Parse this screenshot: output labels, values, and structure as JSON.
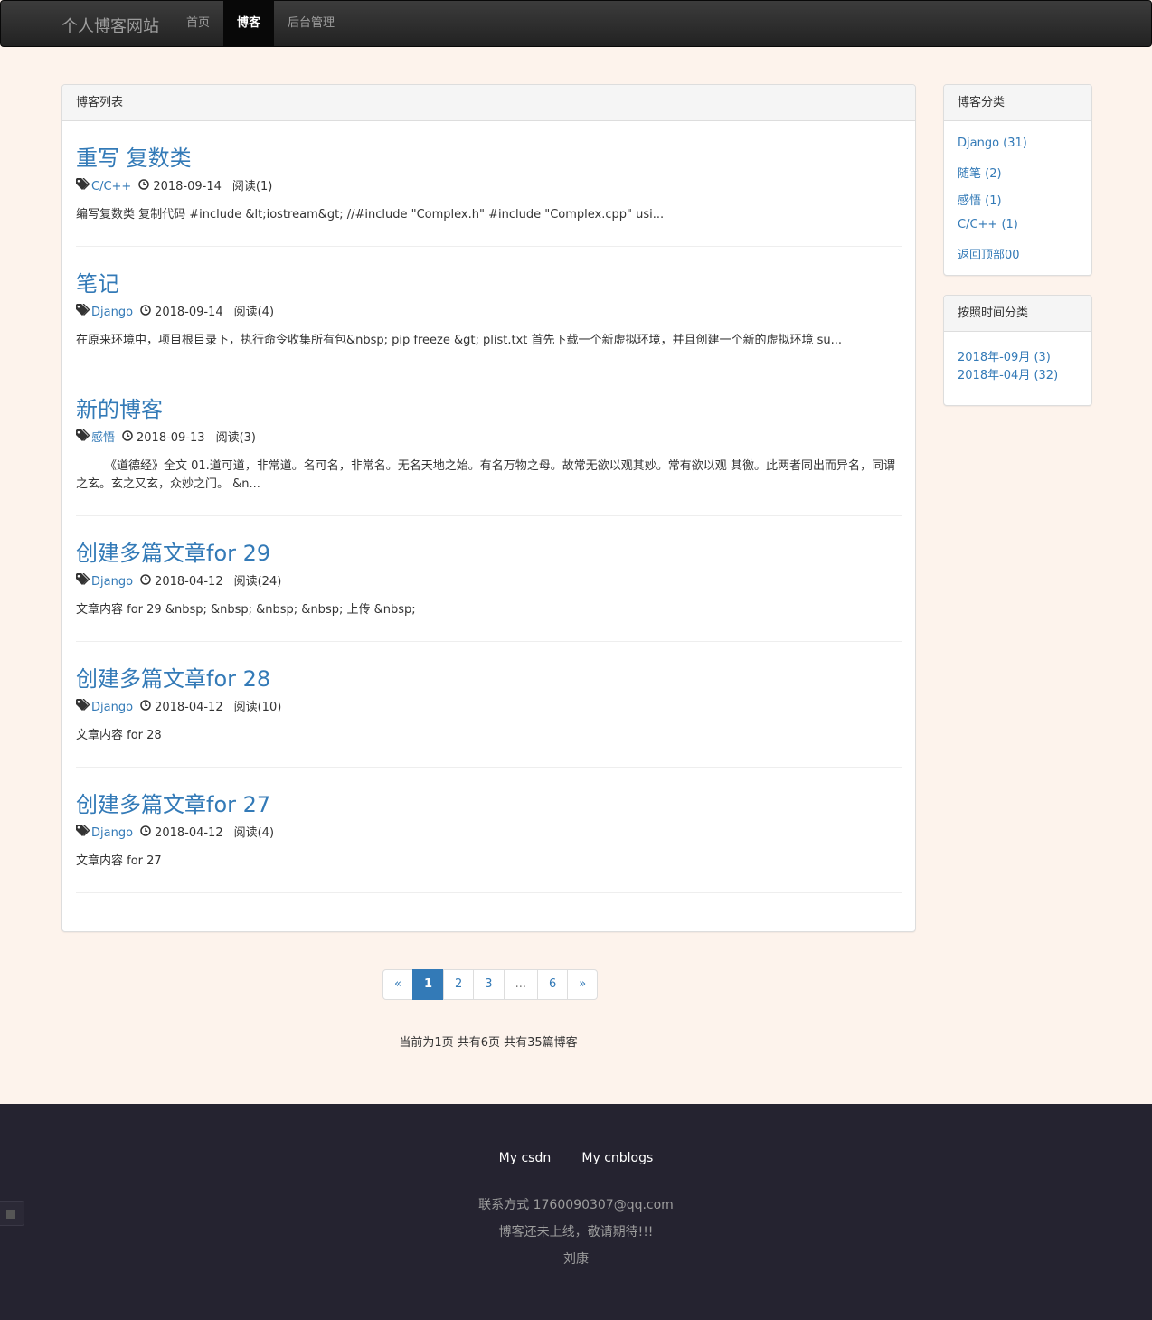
{
  "navbar": {
    "brand": "个人博客网站",
    "items": [
      {
        "label": "首页",
        "active": false
      },
      {
        "label": "博客",
        "active": true
      },
      {
        "label": "后台管理",
        "active": false
      }
    ]
  },
  "main": {
    "heading": "博客列表",
    "posts": [
      {
        "title": "重写 复数类",
        "category": "C/C++",
        "date": "2018-09-14",
        "views": "阅读(1)",
        "summary": "编写复数类 复制代码 #include &lt;iostream&gt; //#include \"Complex.h\" #include \"Complex.cpp\" usi..."
      },
      {
        "title": "笔记",
        "category": "Django",
        "date": "2018-09-14",
        "views": "阅读(4)",
        "summary": "在原来环境中，项目根目录下，执行命令收集所有包&nbsp; pip freeze &gt; plist.txt 首先下载一个新虚拟环境，并且创建一个新的虚拟环境 su..."
      },
      {
        "title": "新的博客",
        "category": "感悟",
        "date": "2018-09-13",
        "views": "阅读(3)",
        "summary": "《道德经》全文 01.道可道，非常道。名可名，非常名。无名天地之始。有名万物之母。故常无欲以观其妙。常有欲以观 其徼。此两者同出而异名，同谓之玄。玄之又玄，众妙之门。 &n..."
      },
      {
        "title": "创建多篇文章for 29",
        "category": "Django",
        "date": "2018-04-12",
        "views": "阅读(24)",
        "summary": "文章内容 for 29 &nbsp; &nbsp; &nbsp; &nbsp; 上传 &nbsp;"
      },
      {
        "title": "创建多篇文章for 28",
        "category": "Django",
        "date": "2018-04-12",
        "views": "阅读(10)",
        "summary": "文章内容 for 28"
      },
      {
        "title": "创建多篇文章for 27",
        "category": "Django",
        "date": "2018-04-12",
        "views": "阅读(4)",
        "summary": "文章内容 for 27"
      }
    ]
  },
  "sidebar": {
    "categories": {
      "heading": "博客分类",
      "items": [
        "Django (31)",
        "随笔 (2)",
        "感悟 (1)",
        "C/C++ (1)",
        "返回顶部00"
      ]
    },
    "archives": {
      "heading": "按照时间分类",
      "items": [
        "2018年-09月 (3)",
        "2018年-04月 (32)"
      ]
    }
  },
  "pagination": {
    "pages": [
      {
        "label": "«",
        "state": "normal"
      },
      {
        "label": "1",
        "state": "active"
      },
      {
        "label": "2",
        "state": "normal"
      },
      {
        "label": "3",
        "state": "normal"
      },
      {
        "label": "...",
        "state": "disabled"
      },
      {
        "label": "6",
        "state": "normal"
      },
      {
        "label": "»",
        "state": "normal"
      }
    ],
    "info": "当前为1页 共有6页 共有35篇博客"
  },
  "footer": {
    "links": [
      "My csdn",
      "My cnblogs"
    ],
    "contact": "联系方式 1760090307@qq.com",
    "notice": "博客还未上线，敬请期待!!!",
    "author": "刘康"
  },
  "colors": {
    "page_background": "#fdf3ec",
    "navbar": "#222222",
    "link": "#337ab7",
    "footer": "#252330"
  }
}
